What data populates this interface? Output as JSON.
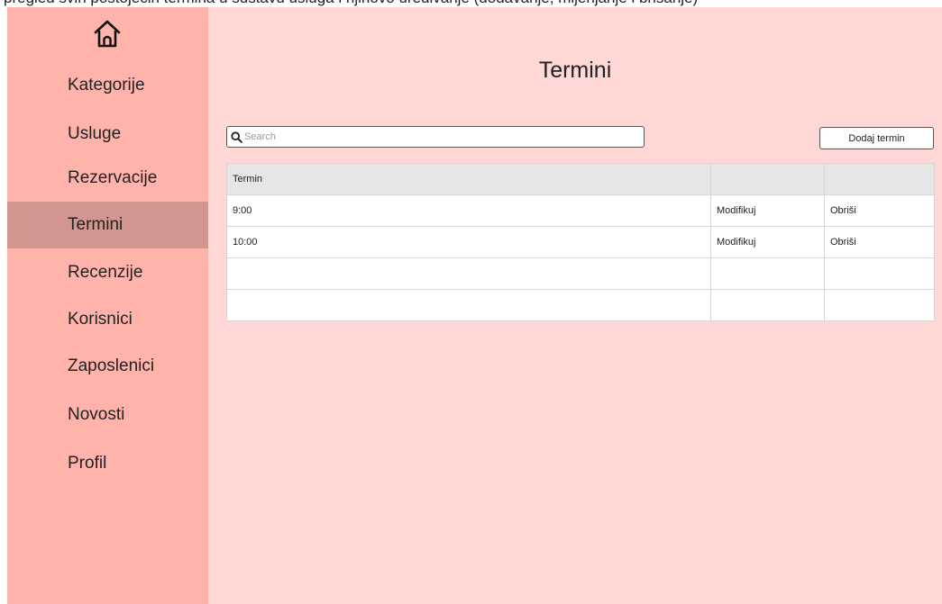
{
  "top_strip_text": "pregled svih postojećih termina u sustavu usluga i njihovo uređivanje (dodavanje, mijenjanje i brisanje)",
  "sidebar": {
    "items": [
      {
        "label": "Kategorije",
        "active": false
      },
      {
        "label": "Usluge",
        "active": false
      },
      {
        "label": "Rezervacije",
        "active": false
      },
      {
        "label": "Termini",
        "active": true
      },
      {
        "label": "Recenzije",
        "active": false
      },
      {
        "label": "Korisnici",
        "active": false
      },
      {
        "label": "Zaposlenici",
        "active": false
      },
      {
        "label": "Novosti",
        "active": false
      },
      {
        "label": "Profil",
        "active": false
      }
    ]
  },
  "main": {
    "title": "Termini",
    "search": {
      "placeholder": "Search",
      "value": ""
    },
    "add_button": "Dodaj termin",
    "table": {
      "headers": [
        "Termin",
        "",
        ""
      ],
      "rows": [
        {
          "termin": "9:00",
          "modify": "Modifikuj",
          "delete": "Obriši"
        },
        {
          "termin": "10:00",
          "modify": "Modifikuj",
          "delete": "Obriši"
        },
        {
          "termin": "",
          "modify": "",
          "delete": ""
        },
        {
          "termin": "",
          "modify": "",
          "delete": ""
        }
      ]
    }
  },
  "colors": {
    "sidebar": "#ffb3ab",
    "sidebar_active": "#d19690",
    "main_bg": "#ffd8d6",
    "modify": "#5fa34a",
    "delete": "#e0403a"
  },
  "icons": {
    "home": "home-icon",
    "search": "search-icon"
  }
}
